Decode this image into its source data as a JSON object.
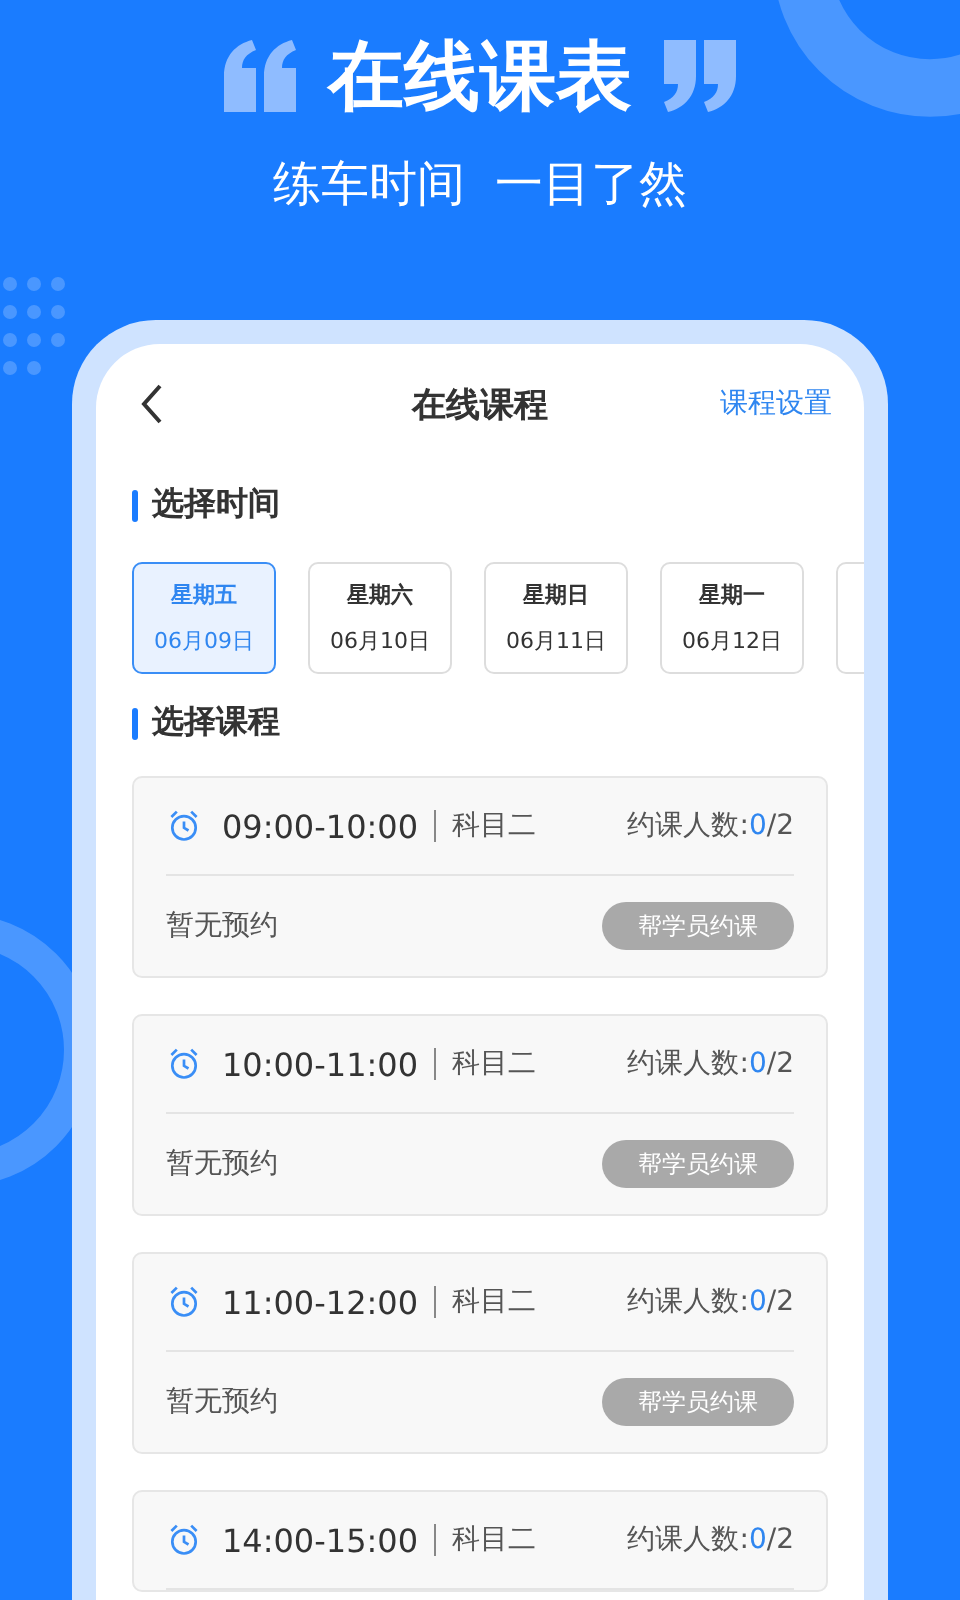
{
  "banner": {
    "title": "在线课表",
    "subtitle": "练车时间  一目了然"
  },
  "header": {
    "title": "在线课程",
    "action": "课程设置"
  },
  "date_section": {
    "title": "选择时间"
  },
  "dates": [
    {
      "weekday": "星期五",
      "date": "06月09日",
      "selected": true
    },
    {
      "weekday": "星期六",
      "date": "06月10日",
      "selected": false
    },
    {
      "weekday": "星期日",
      "date": "06月11日",
      "selected": false
    },
    {
      "weekday": "星期一",
      "date": "06月12日",
      "selected": false
    },
    {
      "selected": false
    }
  ],
  "course_section": {
    "title": "选择课程"
  },
  "courses": [
    {
      "time": "09:00-10:00",
      "subject": "科目二",
      "count_label": "约课人数:",
      "booked": "0",
      "capacity": "/2",
      "status": "暂无预约",
      "button": "帮学员约课",
      "disabled": true
    },
    {
      "time": "10:00-11:00",
      "subject": "科目二",
      "count_label": "约课人数:",
      "booked": "0",
      "capacity": "/2",
      "status": "暂无预约",
      "button": "帮学员约课",
      "disabled": true
    },
    {
      "time": "11:00-12:00",
      "subject": "科目二",
      "count_label": "约课人数:",
      "booked": "0",
      "capacity": "/2",
      "status": "暂无预约",
      "button": "帮学员约课",
      "disabled": true
    },
    {
      "time": "14:00-15:00",
      "subject": "科目二",
      "count_label": "约课人数:",
      "booked": "0",
      "capacity": "/2"
    }
  ]
}
